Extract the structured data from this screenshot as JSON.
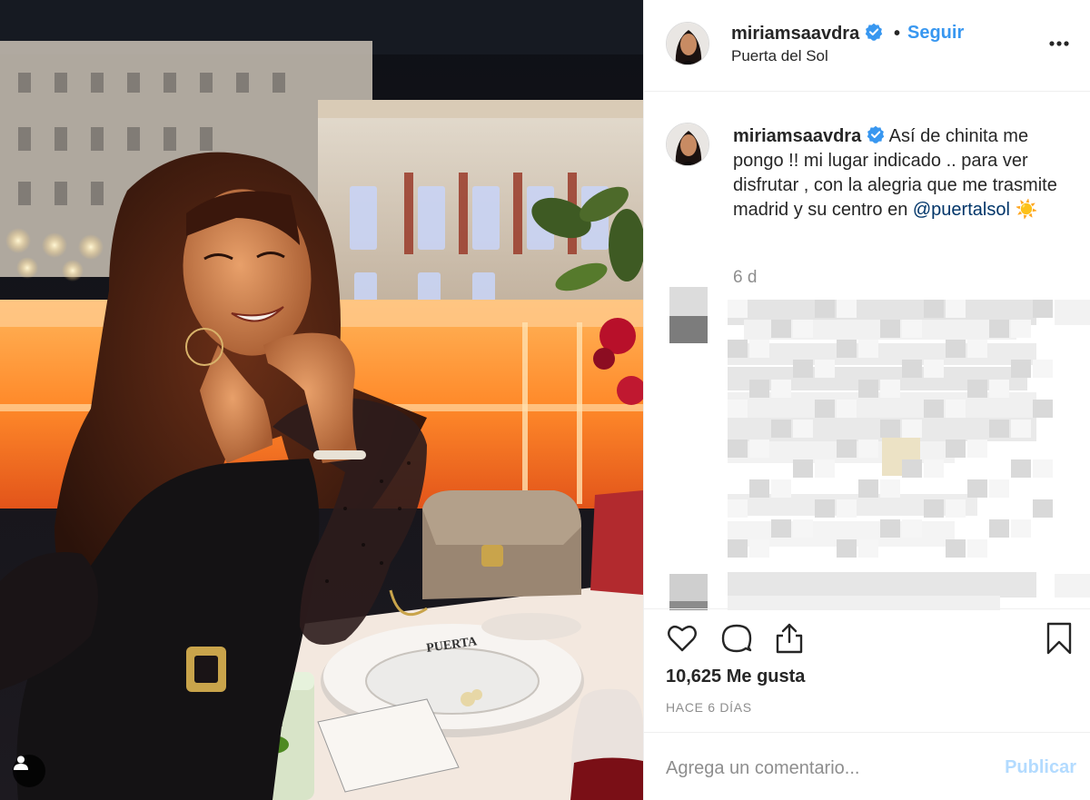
{
  "post": {
    "username": "miriamsaavdra",
    "verified_icon": "verified-badge-icon",
    "separator": "•",
    "follow_label": "Seguir",
    "location": "Puerta del Sol",
    "more_icon": "more-options-icon"
  },
  "caption": {
    "username": "miriamsaavdra",
    "text": "Así de chinita me pongo !! mi lugar indicado .. para ver disfrutar , con la alegria que me trasmite madrid y su centro en ",
    "mention": "@puertalsol",
    "emoji": "☀️",
    "time_ago": "6 d"
  },
  "actions": {
    "like_icon": "heart-icon",
    "comment_icon": "comment-icon",
    "share_icon": "share-icon",
    "save_icon": "bookmark-icon"
  },
  "likes_text": "10,625 Me gusta",
  "date_text": "HACE 6 DÍAS",
  "comment": {
    "placeholder": "Agrega un comentario...",
    "publish_label": "Publicar"
  },
  "colors": {
    "accent": "#3897f0",
    "publish_disabled": "#b3dbff",
    "secondary_text": "#8e8e8e",
    "mention": "#003569"
  }
}
